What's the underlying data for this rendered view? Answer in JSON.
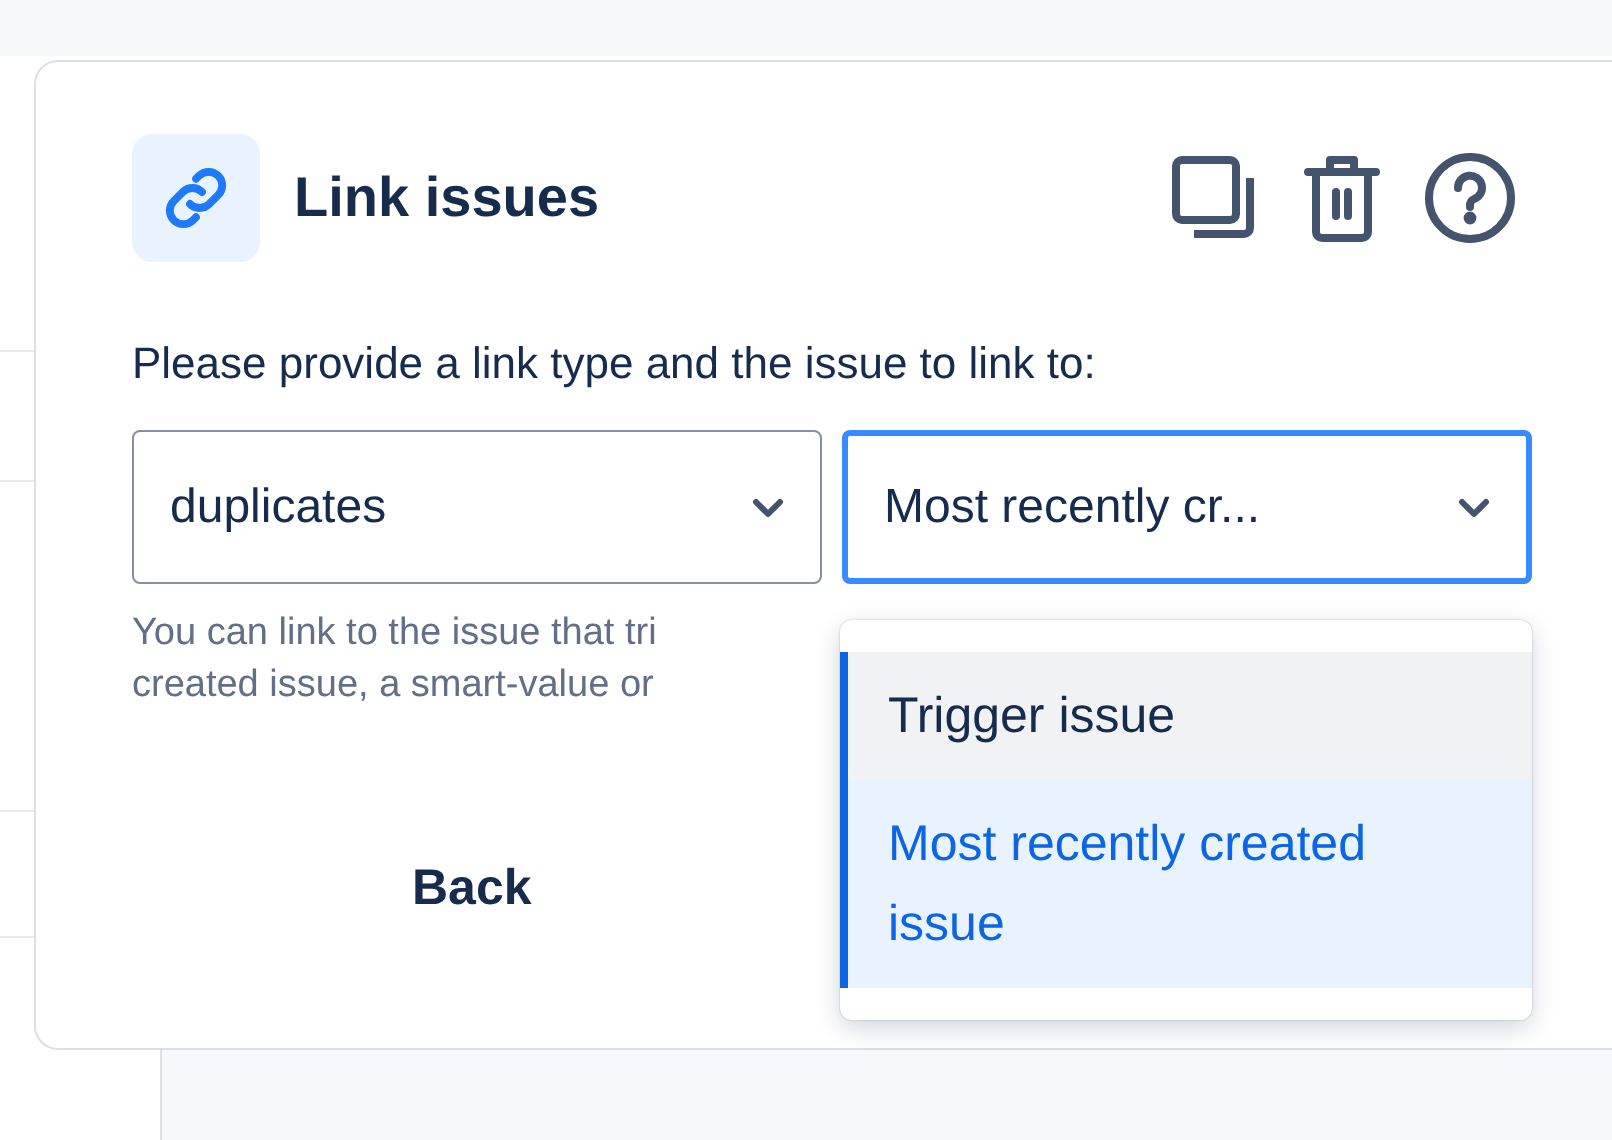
{
  "dialog": {
    "title": "Link issues",
    "actions": [
      {
        "kind": "copy"
      },
      {
        "kind": "delete"
      },
      {
        "kind": "help"
      }
    ]
  },
  "prompt": "Please provide a link type and the issue to link to:",
  "selects": [
    {
      "value": "duplicates",
      "focused": false
    },
    {
      "value": "Most recently cr...",
      "focused": true
    }
  ],
  "helper_lines": [
    "You can link to the issue that tri",
    "created issue, a smart-value or"
  ],
  "back_button": "Back",
  "menu": {
    "items": [
      {
        "label": "Trigger issue",
        "highlighted": true,
        "selected": false
      },
      {
        "label": "Most recently created issue",
        "highlighted": false,
        "selected": true
      }
    ]
  }
}
